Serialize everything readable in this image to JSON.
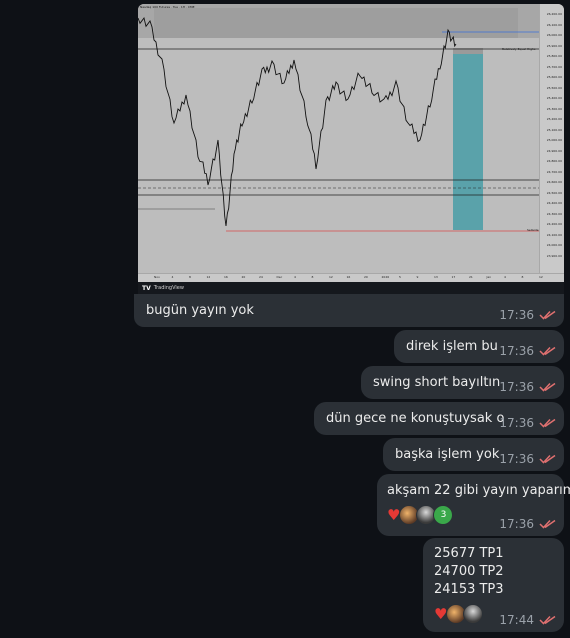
{
  "chart": {
    "header": "Nasdaq 100 Futures · Tue · 1H · CME",
    "subheader": "Relatively Equal Highs",
    "annotation_eqh": "Relatively Equal Highs",
    "annotation_sellside": "Sellside",
    "price_ticks": [
      "26,200.00",
      "26,100.00",
      "26,000.00",
      "25,900.00",
      "25,800.00",
      "25,700.00",
      "25,600.00",
      "25,500.00",
      "25,400.00",
      "25,300.00",
      "25,200.00",
      "25,100.00",
      "25,000.00",
      "24,900.00",
      "24,800.00",
      "24,700.00",
      "24,600.00",
      "24,500.00",
      "24,400.00",
      "24,300.00",
      "24,200.00",
      "24,100.00",
      "24,000.00",
      "23,900.00"
    ],
    "time_ticks": [
      "Nov",
      "4",
      "8",
      "12",
      "16",
      "20",
      "24",
      "Dec",
      "4",
      "8",
      "12",
      "16",
      "20",
      "2026",
      "5",
      "9",
      "13",
      "17",
      "21",
      "Jan",
      "4",
      "8",
      "12"
    ],
    "footer_brand": "TradingView",
    "colors": {
      "background": "#bdbdbd",
      "target_box": "#4f9ea7",
      "sellside_line": "#d84a4a",
      "eqh_line": "#3a6fd8"
    }
  },
  "messages": [
    {
      "text": "bugün yayın yok",
      "time": "17:36"
    },
    {
      "text": "direk işlem bu",
      "time": "17:36"
    },
    {
      "text": "swing short bayıltın",
      "time": "17:36"
    },
    {
      "text": "dün gece ne konuştuysak o",
      "time": "17:36"
    },
    {
      "text": "başka işlem yok",
      "time": "17:36"
    },
    {
      "text": "akşam 22 gibi yayın yaparım",
      "time": "17:36",
      "reaction_count": "3"
    },
    {
      "lines": [
        "25677 TP1",
        "24700 TP2",
        "24153 TP3"
      ],
      "time": "17:44"
    }
  ]
}
